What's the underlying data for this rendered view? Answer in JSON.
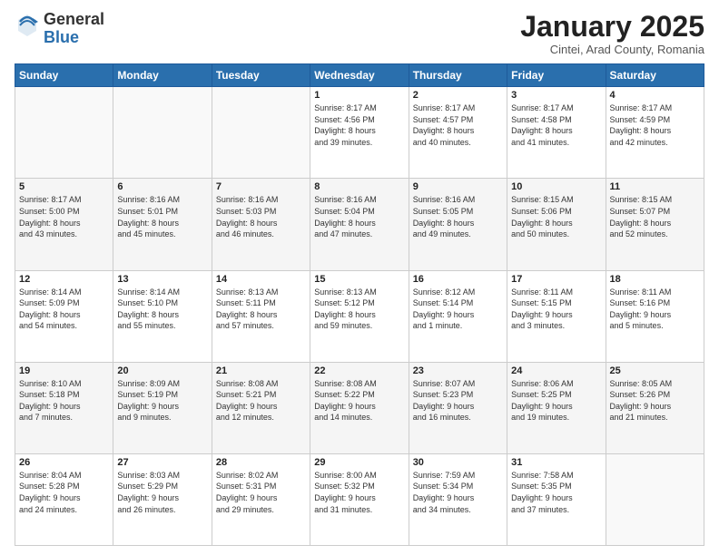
{
  "logo": {
    "general": "General",
    "blue": "Blue"
  },
  "header": {
    "month": "January 2025",
    "location": "Cintei, Arad County, Romania"
  },
  "days_of_week": [
    "Sunday",
    "Monday",
    "Tuesday",
    "Wednesday",
    "Thursday",
    "Friday",
    "Saturday"
  ],
  "weeks": [
    [
      {
        "day": "",
        "info": ""
      },
      {
        "day": "",
        "info": ""
      },
      {
        "day": "",
        "info": ""
      },
      {
        "day": "1",
        "info": "Sunrise: 8:17 AM\nSunset: 4:56 PM\nDaylight: 8 hours\nand 39 minutes."
      },
      {
        "day": "2",
        "info": "Sunrise: 8:17 AM\nSunset: 4:57 PM\nDaylight: 8 hours\nand 40 minutes."
      },
      {
        "day": "3",
        "info": "Sunrise: 8:17 AM\nSunset: 4:58 PM\nDaylight: 8 hours\nand 41 minutes."
      },
      {
        "day": "4",
        "info": "Sunrise: 8:17 AM\nSunset: 4:59 PM\nDaylight: 8 hours\nand 42 minutes."
      }
    ],
    [
      {
        "day": "5",
        "info": "Sunrise: 8:17 AM\nSunset: 5:00 PM\nDaylight: 8 hours\nand 43 minutes."
      },
      {
        "day": "6",
        "info": "Sunrise: 8:16 AM\nSunset: 5:01 PM\nDaylight: 8 hours\nand 45 minutes."
      },
      {
        "day": "7",
        "info": "Sunrise: 8:16 AM\nSunset: 5:03 PM\nDaylight: 8 hours\nand 46 minutes."
      },
      {
        "day": "8",
        "info": "Sunrise: 8:16 AM\nSunset: 5:04 PM\nDaylight: 8 hours\nand 47 minutes."
      },
      {
        "day": "9",
        "info": "Sunrise: 8:16 AM\nSunset: 5:05 PM\nDaylight: 8 hours\nand 49 minutes."
      },
      {
        "day": "10",
        "info": "Sunrise: 8:15 AM\nSunset: 5:06 PM\nDaylight: 8 hours\nand 50 minutes."
      },
      {
        "day": "11",
        "info": "Sunrise: 8:15 AM\nSunset: 5:07 PM\nDaylight: 8 hours\nand 52 minutes."
      }
    ],
    [
      {
        "day": "12",
        "info": "Sunrise: 8:14 AM\nSunset: 5:09 PM\nDaylight: 8 hours\nand 54 minutes."
      },
      {
        "day": "13",
        "info": "Sunrise: 8:14 AM\nSunset: 5:10 PM\nDaylight: 8 hours\nand 55 minutes."
      },
      {
        "day": "14",
        "info": "Sunrise: 8:13 AM\nSunset: 5:11 PM\nDaylight: 8 hours\nand 57 minutes."
      },
      {
        "day": "15",
        "info": "Sunrise: 8:13 AM\nSunset: 5:12 PM\nDaylight: 8 hours\nand 59 minutes."
      },
      {
        "day": "16",
        "info": "Sunrise: 8:12 AM\nSunset: 5:14 PM\nDaylight: 9 hours\nand 1 minute."
      },
      {
        "day": "17",
        "info": "Sunrise: 8:11 AM\nSunset: 5:15 PM\nDaylight: 9 hours\nand 3 minutes."
      },
      {
        "day": "18",
        "info": "Sunrise: 8:11 AM\nSunset: 5:16 PM\nDaylight: 9 hours\nand 5 minutes."
      }
    ],
    [
      {
        "day": "19",
        "info": "Sunrise: 8:10 AM\nSunset: 5:18 PM\nDaylight: 9 hours\nand 7 minutes."
      },
      {
        "day": "20",
        "info": "Sunrise: 8:09 AM\nSunset: 5:19 PM\nDaylight: 9 hours\nand 9 minutes."
      },
      {
        "day": "21",
        "info": "Sunrise: 8:08 AM\nSunset: 5:21 PM\nDaylight: 9 hours\nand 12 minutes."
      },
      {
        "day": "22",
        "info": "Sunrise: 8:08 AM\nSunset: 5:22 PM\nDaylight: 9 hours\nand 14 minutes."
      },
      {
        "day": "23",
        "info": "Sunrise: 8:07 AM\nSunset: 5:23 PM\nDaylight: 9 hours\nand 16 minutes."
      },
      {
        "day": "24",
        "info": "Sunrise: 8:06 AM\nSunset: 5:25 PM\nDaylight: 9 hours\nand 19 minutes."
      },
      {
        "day": "25",
        "info": "Sunrise: 8:05 AM\nSunset: 5:26 PM\nDaylight: 9 hours\nand 21 minutes."
      }
    ],
    [
      {
        "day": "26",
        "info": "Sunrise: 8:04 AM\nSunset: 5:28 PM\nDaylight: 9 hours\nand 24 minutes."
      },
      {
        "day": "27",
        "info": "Sunrise: 8:03 AM\nSunset: 5:29 PM\nDaylight: 9 hours\nand 26 minutes."
      },
      {
        "day": "28",
        "info": "Sunrise: 8:02 AM\nSunset: 5:31 PM\nDaylight: 9 hours\nand 29 minutes."
      },
      {
        "day": "29",
        "info": "Sunrise: 8:00 AM\nSunset: 5:32 PM\nDaylight: 9 hours\nand 31 minutes."
      },
      {
        "day": "30",
        "info": "Sunrise: 7:59 AM\nSunset: 5:34 PM\nDaylight: 9 hours\nand 34 minutes."
      },
      {
        "day": "31",
        "info": "Sunrise: 7:58 AM\nSunset: 5:35 PM\nDaylight: 9 hours\nand 37 minutes."
      },
      {
        "day": "",
        "info": ""
      }
    ]
  ]
}
